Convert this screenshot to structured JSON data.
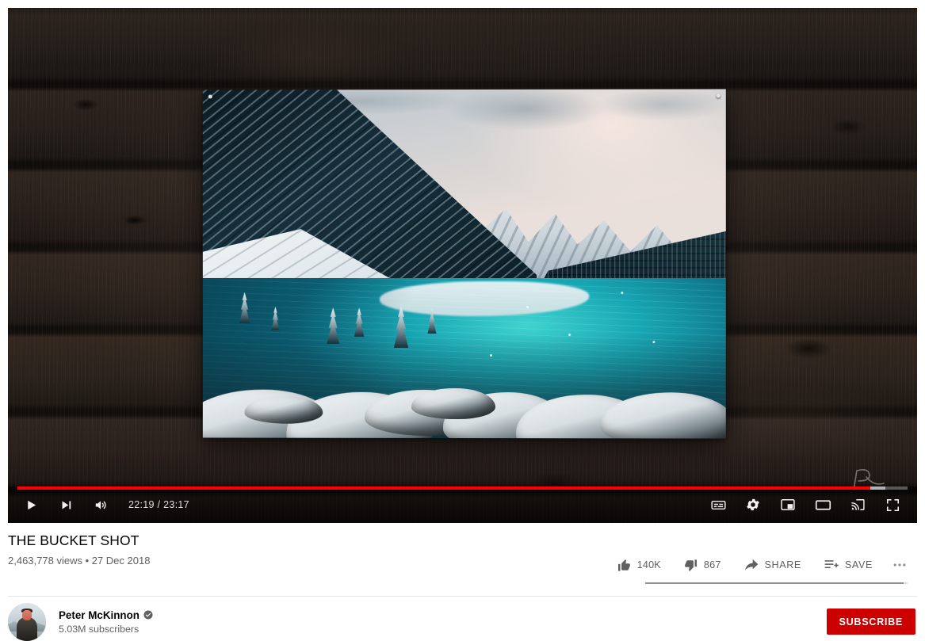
{
  "player": {
    "time_display": "22:19 / 23:17",
    "current_time": "22:19",
    "duration": "23:17",
    "progress_percent": 95.8,
    "loaded_percent": 97.5,
    "progress_color": "#ff0000",
    "controls_left": [
      {
        "name": "play-icon",
        "label": "Play"
      },
      {
        "name": "next-video-icon",
        "label": "Next"
      },
      {
        "name": "volume-icon",
        "label": "Mute"
      }
    ],
    "controls_right": [
      {
        "name": "subtitles-icon",
        "label": "Subtitles/closed captions"
      },
      {
        "name": "settings-gear-icon",
        "label": "Settings"
      },
      {
        "name": "miniplayer-icon",
        "label": "Miniplayer"
      },
      {
        "name": "theater-mode-icon",
        "label": "Theater mode"
      },
      {
        "name": "cast-icon",
        "label": "Play on TV"
      },
      {
        "name": "fullscreen-icon",
        "label": "Full screen"
      }
    ],
    "watermark": "pm-signature-watermark"
  },
  "video": {
    "title": "THE BUCKET SHOT",
    "views": "2,463,778 views",
    "separator": "•",
    "upload_date": "27 Dec 2018",
    "subline": "2,463,778 views • 27 Dec 2018"
  },
  "actions": {
    "like": {
      "label": "140K",
      "icon": "thumbs-up-icon"
    },
    "dislike": {
      "label": "867",
      "icon": "thumbs-down-icon"
    },
    "share": {
      "label": "SHARE",
      "icon": "share-arrow-icon"
    },
    "save": {
      "label": "SAVE",
      "icon": "save-playlist-icon"
    },
    "more": {
      "label": "•••",
      "icon": "more-actions-icon"
    },
    "ratio_percent": 98.4
  },
  "channel": {
    "name": "Peter McKinnon",
    "verified_badge": "verified-check-icon",
    "subscribers": "5.03M subscribers",
    "subscribe_label": "SUBSCRIBE",
    "subscribe_color": "#cc0000"
  },
  "artwork": {
    "description": "snowy-mountain-lake-print-on-wood-wall",
    "scene": "Moraine Lake turquoise water with snow covered peaks and foreground rocks"
  }
}
